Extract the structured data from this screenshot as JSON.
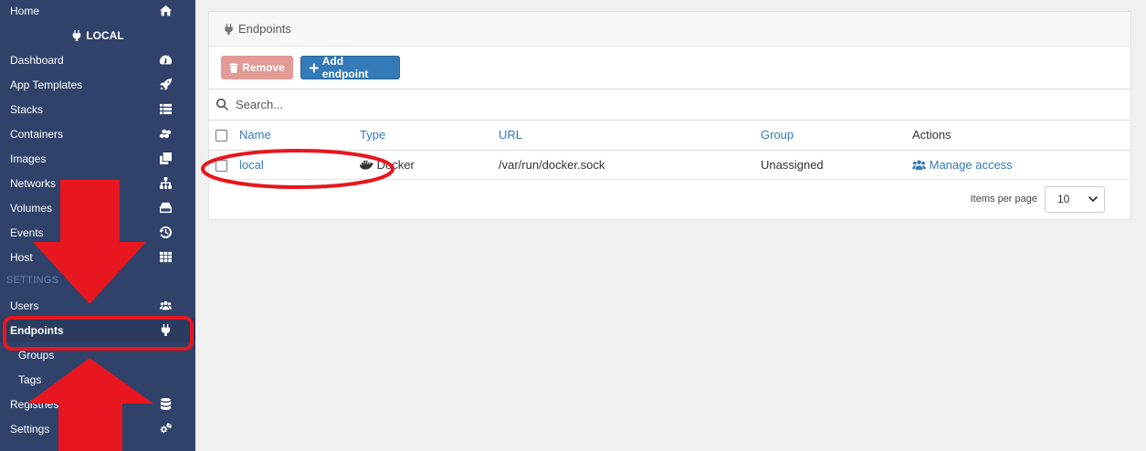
{
  "sidebar": {
    "items_top": [
      {
        "label": "Home",
        "icon": "home-icon"
      }
    ],
    "env_header": "LOCAL",
    "items": [
      {
        "label": "Dashboard",
        "icon": "tachometer-icon"
      },
      {
        "label": "App Templates",
        "icon": "rocket-icon"
      },
      {
        "label": "Stacks",
        "icon": "list-icon"
      },
      {
        "label": "Containers",
        "icon": "cubes-icon"
      },
      {
        "label": "Images",
        "icon": "clone-icon"
      },
      {
        "label": "Networks",
        "icon": "sitemap-icon"
      },
      {
        "label": "Volumes",
        "icon": "hdd-icon"
      },
      {
        "label": "Events",
        "icon": "history-icon"
      },
      {
        "label": "Host",
        "icon": "th-icon"
      }
    ],
    "settings_label": "SETTINGS",
    "settings_items": [
      {
        "label": "Users",
        "icon": "users-icon"
      },
      {
        "label": "Endpoints",
        "icon": "plug-icon"
      },
      {
        "label": "Groups"
      },
      {
        "label": "Tags"
      },
      {
        "label": "Registries",
        "icon": "database-icon"
      },
      {
        "label": "Settings",
        "icon": "cogs-icon"
      }
    ]
  },
  "panel": {
    "title": "Endpoints",
    "remove_label": "Remove",
    "add_label": "Add endpoint",
    "search_placeholder": "Search...",
    "columns": [
      "Name",
      "Type",
      "URL",
      "Group",
      "Actions"
    ],
    "rows": [
      {
        "name": "local",
        "type": "Docker",
        "url": "/var/run/docker.sock",
        "group": "Unassigned",
        "action": "Manage access"
      }
    ],
    "items_per_page_label": "Items per page",
    "items_per_page_value": "10"
  },
  "colors": {
    "sidebar_bg": "#30426a",
    "accent": "#337ab7",
    "danger": "#e39a95",
    "annotation": "#e8161e"
  }
}
